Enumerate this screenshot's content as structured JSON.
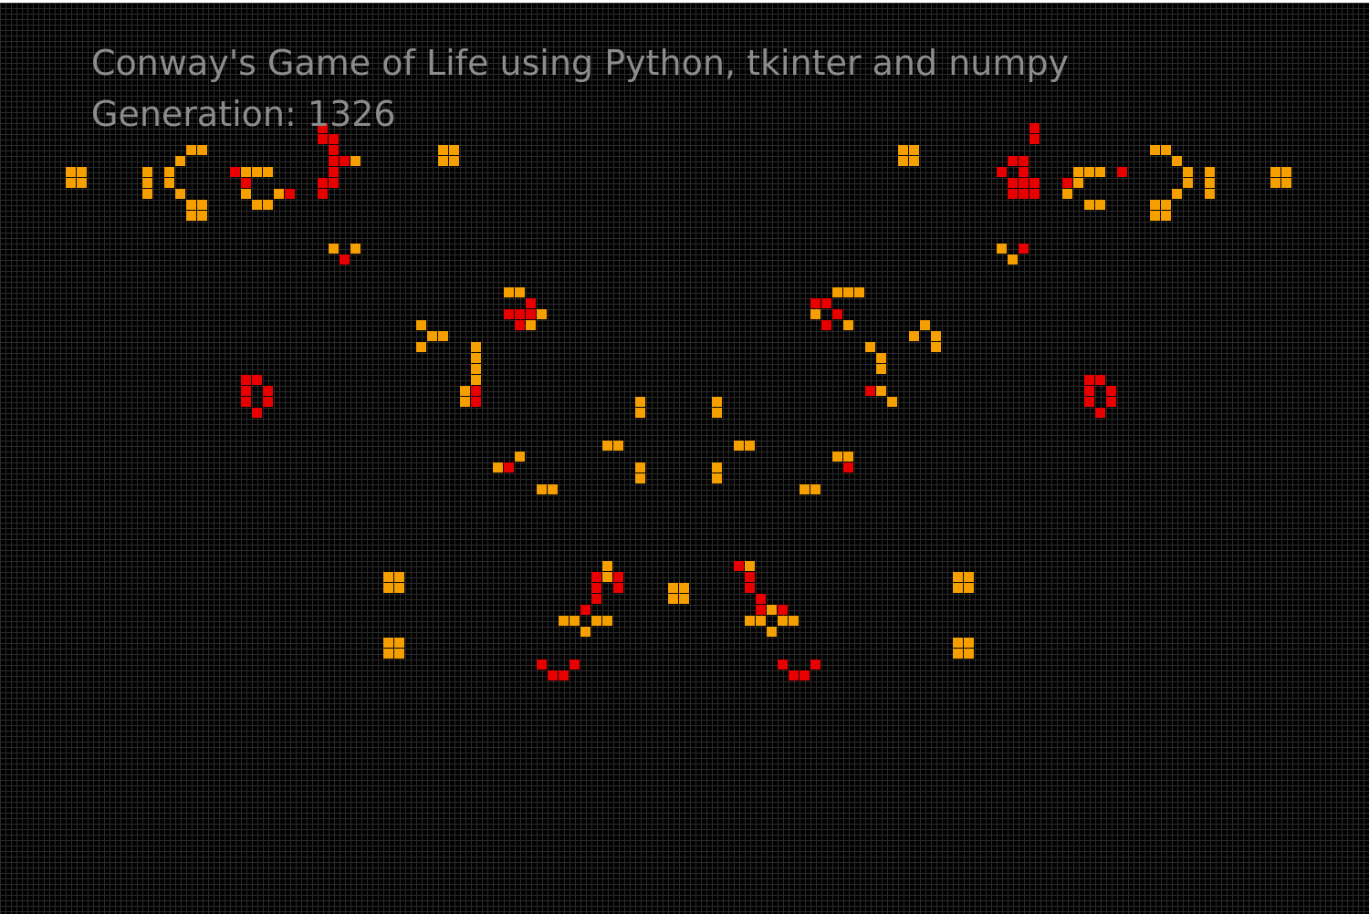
{
  "title": "Conway's Game of Life using Python, tkinter and numpy",
  "generation": {
    "label": "Generation:",
    "value": "1326"
  },
  "colors": {
    "background": "#000000",
    "gridline": "#2b2b2b",
    "text": "#8c8c8c",
    "live_cell": "#f5a000",
    "new_cell": "#e80000"
  },
  "board": {
    "columns": 125,
    "rows": 83,
    "orange_cells": [
      [
        6,
        15
      ],
      [
        7,
        15
      ],
      [
        6,
        16
      ],
      [
        7,
        16
      ],
      [
        13,
        15
      ],
      [
        13,
        16
      ],
      [
        13,
        17
      ],
      [
        15,
        15
      ],
      [
        15,
        16
      ],
      [
        16,
        14
      ],
      [
        16,
        17
      ],
      [
        17,
        13
      ],
      [
        18,
        13
      ],
      [
        17,
        18
      ],
      [
        18,
        18
      ],
      [
        17,
        19
      ],
      [
        18,
        19
      ],
      [
        22,
        15
      ],
      [
        22,
        16
      ],
      [
        23,
        15
      ],
      [
        24,
        15
      ],
      [
        22,
        17
      ],
      [
        23,
        18
      ],
      [
        24,
        18
      ],
      [
        25,
        17
      ],
      [
        32,
        14
      ],
      [
        40,
        13
      ],
      [
        41,
        13
      ],
      [
        40,
        14
      ],
      [
        41,
        14
      ],
      [
        30,
        22
      ],
      [
        32,
        22
      ],
      [
        31,
        23
      ],
      [
        46,
        26
      ],
      [
        47,
        26
      ],
      [
        48,
        27
      ],
      [
        49,
        28
      ],
      [
        47,
        29
      ],
      [
        48,
        29
      ],
      [
        38,
        29
      ],
      [
        39,
        30
      ],
      [
        40,
        30
      ],
      [
        38,
        31
      ],
      [
        43,
        31
      ],
      [
        43,
        32
      ],
      [
        43,
        33
      ],
      [
        43,
        34
      ],
      [
        42,
        35
      ],
      [
        42,
        36
      ],
      [
        43,
        36
      ],
      [
        45,
        42
      ],
      [
        46,
        42
      ],
      [
        47,
        41
      ],
      [
        49,
        44
      ],
      [
        50,
        44
      ],
      [
        55,
        40
      ],
      [
        56,
        40
      ],
      [
        58,
        36
      ],
      [
        58,
        37
      ],
      [
        58,
        42
      ],
      [
        58,
        43
      ],
      [
        35,
        52
      ],
      [
        36,
        52
      ],
      [
        35,
        53
      ],
      [
        36,
        53
      ],
      [
        35,
        58
      ],
      [
        36,
        58
      ],
      [
        35,
        59
      ],
      [
        36,
        59
      ],
      [
        55,
        51
      ],
      [
        55,
        52
      ],
      [
        51,
        56
      ],
      [
        52,
        56
      ],
      [
        54,
        56
      ],
      [
        55,
        56
      ],
      [
        53,
        57
      ],
      [
        49,
        60
      ],
      [
        61,
        53
      ],
      [
        62,
        53
      ],
      [
        61,
        54
      ],
      [
        62,
        54
      ],
      [
        65,
        36
      ],
      [
        65,
        37
      ],
      [
        65,
        42
      ],
      [
        65,
        43
      ],
      [
        67,
        40
      ],
      [
        68,
        40
      ],
      [
        68,
        51
      ],
      [
        68,
        52
      ],
      [
        68,
        53
      ],
      [
        68,
        56
      ],
      [
        69,
        56
      ],
      [
        70,
        55
      ],
      [
        71,
        56
      ],
      [
        72,
        56
      ],
      [
        70,
        57
      ],
      [
        73,
        44
      ],
      [
        74,
        44
      ],
      [
        76,
        41
      ],
      [
        77,
        41
      ],
      [
        74,
        28
      ],
      [
        75,
        29
      ],
      [
        76,
        26
      ],
      [
        77,
        26
      ],
      [
        77,
        29
      ],
      [
        78,
        26
      ],
      [
        79,
        31
      ],
      [
        80,
        32
      ],
      [
        80,
        33
      ],
      [
        79,
        35
      ],
      [
        80,
        35
      ],
      [
        81,
        36
      ],
      [
        83,
        30
      ],
      [
        84,
        29
      ],
      [
        85,
        30
      ],
      [
        85,
        31
      ],
      [
        82,
        13
      ],
      [
        83,
        13
      ],
      [
        82,
        14
      ],
      [
        83,
        14
      ],
      [
        87,
        52
      ],
      [
        88,
        52
      ],
      [
        87,
        53
      ],
      [
        88,
        53
      ],
      [
        87,
        58
      ],
      [
        88,
        58
      ],
      [
        87,
        59
      ],
      [
        88,
        59
      ],
      [
        91,
        22
      ],
      [
        93,
        22
      ],
      [
        92,
        23
      ],
      [
        98,
        15
      ],
      [
        98,
        16
      ],
      [
        99,
        15
      ],
      [
        100,
        15
      ],
      [
        97,
        17
      ],
      [
        99,
        18
      ],
      [
        100,
        18
      ],
      [
        105,
        13
      ],
      [
        106,
        13
      ],
      [
        105,
        18
      ],
      [
        106,
        18
      ],
      [
        105,
        19
      ],
      [
        106,
        19
      ],
      [
        107,
        14
      ],
      [
        107,
        17
      ],
      [
        108,
        15
      ],
      [
        108,
        16
      ],
      [
        110,
        15
      ],
      [
        110,
        16
      ],
      [
        110,
        17
      ],
      [
        116,
        15
      ],
      [
        117,
        15
      ],
      [
        116,
        16
      ],
      [
        117,
        16
      ]
    ],
    "red_cells": [
      [
        21,
        15
      ],
      [
        22,
        16
      ],
      [
        26,
        17
      ],
      [
        29,
        11
      ],
      [
        29,
        12
      ],
      [
        30,
        12
      ],
      [
        30,
        13
      ],
      [
        30,
        14
      ],
      [
        31,
        14
      ],
      [
        30,
        15
      ],
      [
        29,
        16
      ],
      [
        30,
        16
      ],
      [
        29,
        17
      ],
      [
        31,
        23
      ],
      [
        22,
        34
      ],
      [
        23,
        34
      ],
      [
        22,
        35
      ],
      [
        24,
        35
      ],
      [
        22,
        36
      ],
      [
        24,
        36
      ],
      [
        23,
        37
      ],
      [
        48,
        27
      ],
      [
        46,
        28
      ],
      [
        47,
        28
      ],
      [
        48,
        28
      ],
      [
        47,
        29
      ],
      [
        43,
        35
      ],
      [
        43,
        36
      ],
      [
        46,
        42
      ],
      [
        54,
        52
      ],
      [
        56,
        52
      ],
      [
        54,
        53
      ],
      [
        56,
        53
      ],
      [
        54,
        54
      ],
      [
        53,
        55
      ],
      [
        49,
        60
      ],
      [
        50,
        61
      ],
      [
        51,
        61
      ],
      [
        52,
        60
      ],
      [
        67,
        51
      ],
      [
        68,
        52
      ],
      [
        68,
        53
      ],
      [
        69,
        54
      ],
      [
        69,
        55
      ],
      [
        71,
        55
      ],
      [
        71,
        60
      ],
      [
        72,
        61
      ],
      [
        73,
        61
      ],
      [
        74,
        60
      ],
      [
        75,
        27
      ],
      [
        74,
        27
      ],
      [
        76,
        28
      ],
      [
        75,
        29
      ],
      [
        79,
        35
      ],
      [
        77,
        42
      ],
      [
        93,
        22
      ],
      [
        92,
        14
      ],
      [
        93,
        14
      ],
      [
        93,
        15
      ],
      [
        93,
        16
      ],
      [
        93,
        17
      ],
      [
        91,
        15
      ],
      [
        92,
        16
      ],
      [
        92,
        17
      ],
      [
        94,
        11
      ],
      [
        94,
        12
      ],
      [
        94,
        16
      ],
      [
        94,
        17
      ],
      [
        97,
        16
      ],
      [
        102,
        15
      ],
      [
        99,
        34
      ],
      [
        100,
        34
      ],
      [
        99,
        35
      ],
      [
        101,
        35
      ],
      [
        99,
        36
      ],
      [
        101,
        36
      ],
      [
        100,
        37
      ]
    ]
  }
}
